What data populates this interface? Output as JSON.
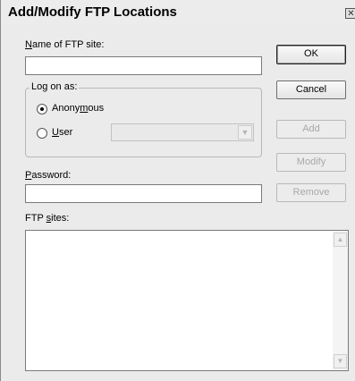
{
  "window": {
    "title": "Add/Modify FTP Locations",
    "close_glyph": "✕"
  },
  "fields": {
    "site_name": {
      "label_pre": "",
      "label_accel": "N",
      "label_post": "ame of FTP site:",
      "value": ""
    },
    "password": {
      "label_pre": "",
      "label_accel": "P",
      "label_post": "assword:",
      "value": ""
    }
  },
  "logon": {
    "group_label": "Log on as:",
    "anonymous": {
      "label_pre": "Anony",
      "label_accel": "m",
      "label_post": "ous",
      "checked": true
    },
    "user": {
      "label_pre": "",
      "label_accel": "U",
      "label_post": "ser",
      "checked": false
    },
    "user_select": {
      "value": "",
      "disabled": true
    }
  },
  "ftp_sites": {
    "label_pre": "FTP ",
    "label_accel": "s",
    "label_post": "ites:",
    "items": []
  },
  "buttons": {
    "ok": "OK",
    "cancel": "Cancel",
    "add": "Add",
    "modify": "Modify",
    "remove": "Remove"
  },
  "icons": {
    "close": "close-icon",
    "radio_selected": "radio-selected-icon",
    "radio_empty": "radio-empty-icon",
    "dropdown": "chevron-down-icon",
    "scroll_up": "scroll-up-icon",
    "scroll_down": "scroll-down-icon"
  }
}
